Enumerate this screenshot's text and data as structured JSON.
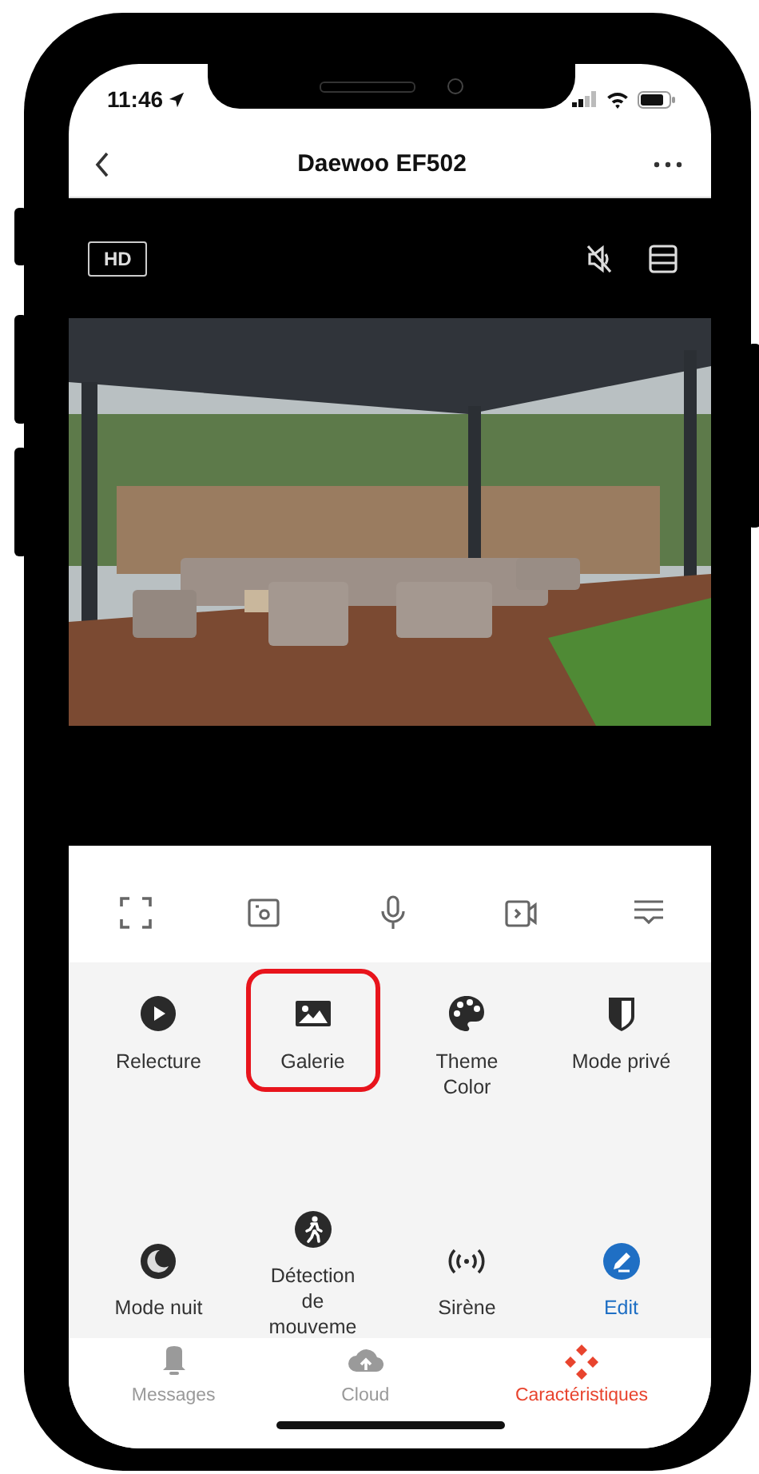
{
  "status_bar": {
    "time": "11:46"
  },
  "nav": {
    "title": "Daewoo EF502"
  },
  "video": {
    "quality": "HD"
  },
  "features": [
    {
      "label": "Relecture",
      "kind": "feature",
      "highlighted": false
    },
    {
      "label": "Galerie",
      "kind": "feature",
      "highlighted": true
    },
    {
      "label": "Theme Color",
      "kind": "feature",
      "highlighted": false
    },
    {
      "label": "Mode privé",
      "kind": "feature",
      "highlighted": false
    },
    {
      "label": "Mode nuit",
      "kind": "feature",
      "highlighted": false
    },
    {
      "label": "Détection de mouveme",
      "kind": "feature",
      "highlighted": false
    },
    {
      "label": "Sirène",
      "kind": "feature",
      "highlighted": false
    },
    {
      "label": "Edit",
      "kind": "action",
      "highlighted": false
    }
  ],
  "tabs": [
    {
      "label": "Messages",
      "selected": false
    },
    {
      "label": "Cloud",
      "selected": false
    },
    {
      "label": "Caractéristiques",
      "selected": true
    }
  ]
}
